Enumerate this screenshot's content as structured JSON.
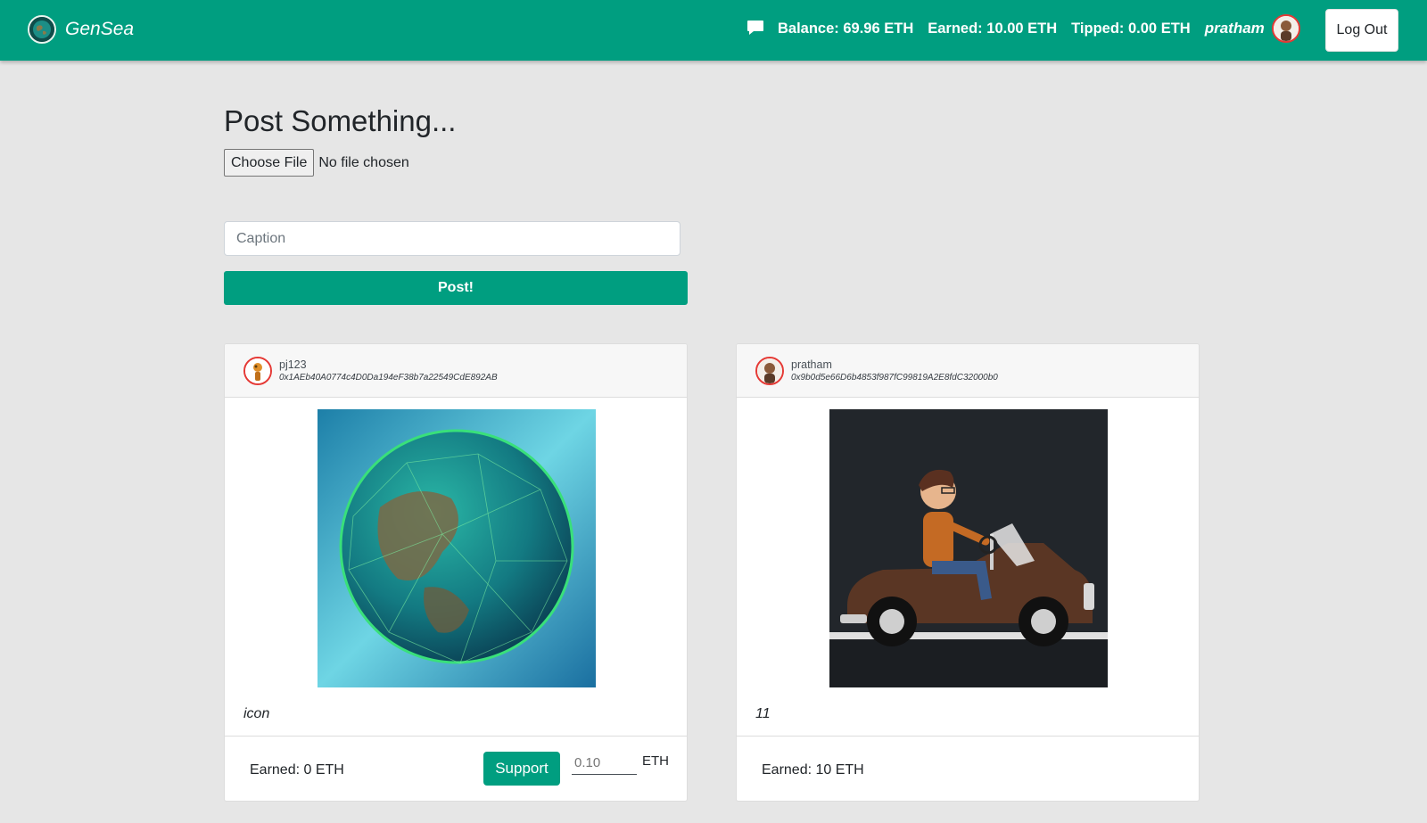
{
  "navbar": {
    "brand": "GenSea",
    "balance": "Balance: 69.96 ETH",
    "earned": "Earned: 10.00 ETH",
    "tipped": "Tipped: 0.00 ETH",
    "username": "pratham",
    "logout_label": "Log Out"
  },
  "post_form": {
    "title": "Post Something...",
    "choose_file_label": "Choose File",
    "file_status": "No file chosen",
    "caption_placeholder": "Caption",
    "caption_value": "",
    "post_label": "Post!"
  },
  "posts": [
    {
      "username": "pj123",
      "address": "0x1AEb40A0774c4D0Da194eF38b7a22549CdE892AB",
      "caption": "icon",
      "earned": "Earned: 0 ETH",
      "support_label": "Support",
      "tip_placeholder": "0.10",
      "tip_unit": "ETH"
    },
    {
      "username": "pratham",
      "address": "0x9b0d5e66D6b4853f987fC99819A2E8fdC32000b0",
      "caption": "11",
      "earned": "Earned: 10 ETH"
    }
  ],
  "colors": {
    "primary": "#009e80",
    "background": "#e6e6e6",
    "avatar_border": "#e53935"
  },
  "icons": {
    "chat": "chat-bubble-icon",
    "brand_logo": "globe-logo-icon"
  }
}
